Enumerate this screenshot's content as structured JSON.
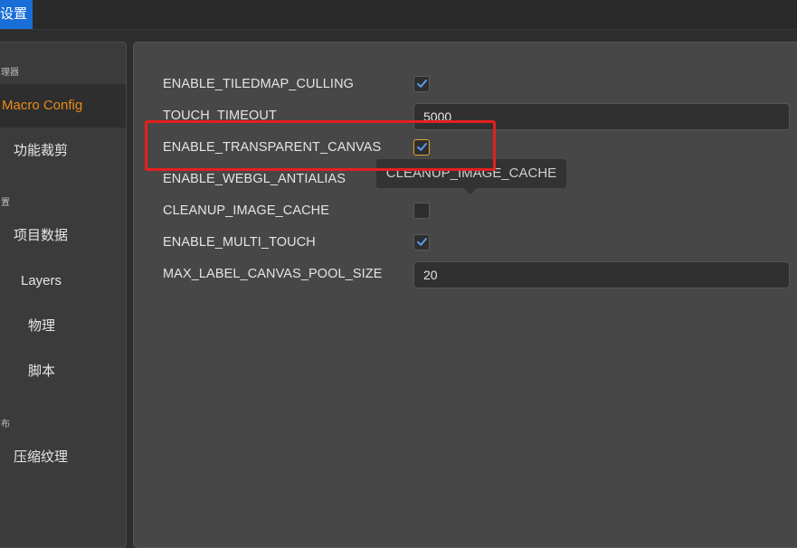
{
  "window": {
    "title": "设置"
  },
  "sidebar": {
    "groups": [
      {
        "label": "理器"
      },
      {
        "label": "置"
      },
      {
        "label": "布"
      }
    ],
    "items": [
      {
        "label": "Macro Config",
        "active": true
      },
      {
        "label": "功能裁剪"
      },
      {
        "label": "项目数据"
      },
      {
        "label": "Layers"
      },
      {
        "label": "物理"
      },
      {
        "label": "脚本"
      },
      {
        "label": "压缩纹理"
      }
    ]
  },
  "macro_config": {
    "rows": [
      {
        "label": "ENABLE_TILEDMAP_CULLING",
        "type": "checkbox",
        "checked": true
      },
      {
        "label": "TOUCH_TIMEOUT",
        "type": "number",
        "value": "5000"
      },
      {
        "label": "ENABLE_TRANSPARENT_CANVAS",
        "type": "checkbox",
        "checked": true,
        "focused": true
      },
      {
        "label": "ENABLE_WEBGL_ANTIALIAS",
        "type": "checkbox",
        "checked": false
      },
      {
        "label": "CLEANUP_IMAGE_CACHE",
        "type": "checkbox",
        "checked": false
      },
      {
        "label": "ENABLE_MULTI_TOUCH",
        "type": "checkbox",
        "checked": true
      },
      {
        "label": "MAX_LABEL_CANVAS_POOL_SIZE",
        "type": "number",
        "value": "20"
      }
    ]
  },
  "tooltip": {
    "text": "CLEANUP_IMAGE_CACHE"
  },
  "colors": {
    "accent": "#e98a19",
    "check": "#5b9bf0",
    "highlight": "#e51f1f",
    "title_tab": "#1a6ed8"
  }
}
